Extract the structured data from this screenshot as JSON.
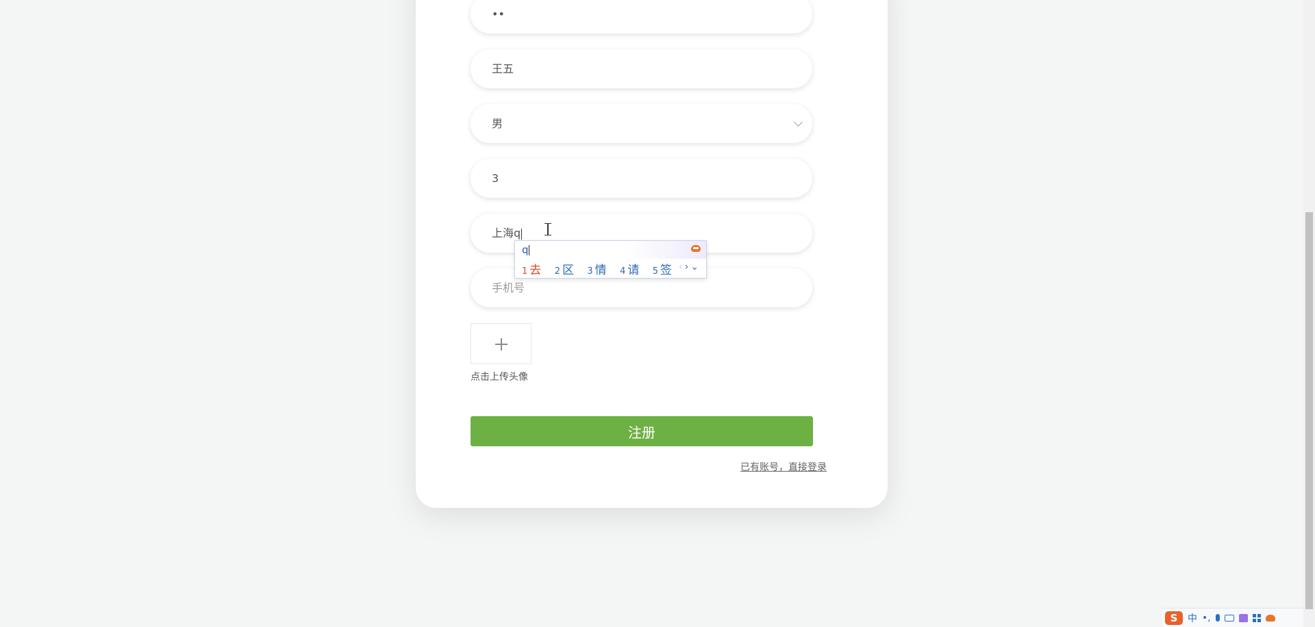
{
  "form": {
    "password_confirm_value": "••",
    "name_value": "王五",
    "gender_value": "男",
    "age_value": "3",
    "address_value": "上海q",
    "phone_placeholder": "手机号",
    "upload_label": "点击上传头像",
    "submit_label": "注册",
    "login_link": "已有账号，直接登录"
  },
  "ime": {
    "composition": "q",
    "candidates": [
      {
        "num": "1",
        "text": "去"
      },
      {
        "num": "2",
        "text": "区"
      },
      {
        "num": "3",
        "text": "情"
      },
      {
        "num": "4",
        "text": "请"
      },
      {
        "num": "5",
        "text": "签"
      }
    ],
    "prev": "‹",
    "next": "›",
    "expand": "⌄"
  },
  "tray": {
    "lang": "中",
    "punct": "•,"
  },
  "colors": {
    "accent_green": "#6db144",
    "ime_selected": "#e0452a",
    "ime_blue": "#2e6ab8"
  }
}
